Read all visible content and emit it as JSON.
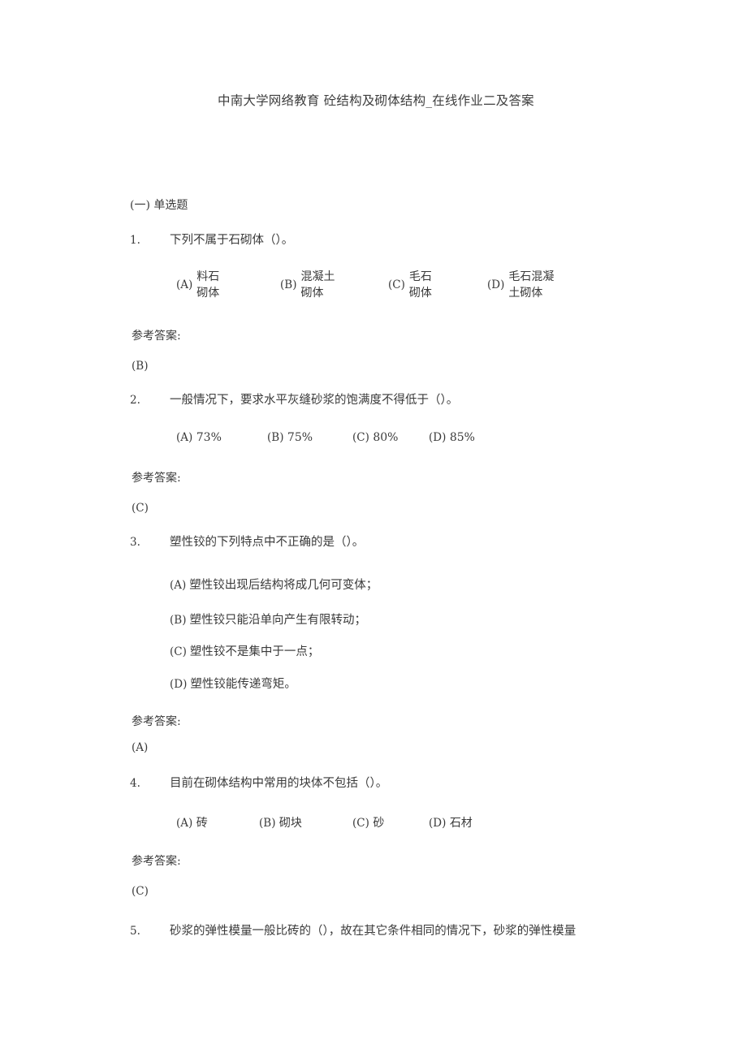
{
  "document": {
    "title": "中南大学网络教育 砼结构及砌体结构_在线作业二及答案",
    "section_header": "(一) 单选题",
    "answer_label": "参考答案:"
  },
  "questions": [
    {
      "number": "1.",
      "text": "下列不属于石砌体（）。",
      "options": [
        {
          "letter": "(A)",
          "line1": "料石",
          "line2": "砌体"
        },
        {
          "letter": "(B)",
          "line1": "混凝土",
          "line2": "砌体"
        },
        {
          "letter": "(C)",
          "line1": "毛石",
          "line2": "砌体"
        },
        {
          "letter": "(D)",
          "line1": "毛石混凝",
          "line2": "土砌体"
        }
      ],
      "answer_label": "参考答案:",
      "answer": "(B)"
    },
    {
      "number": "2.",
      "text": "一般情况下，要求水平灰缝砂浆的饱满度不得低于（）。",
      "options": [
        {
          "letter": "(A)",
          "text": "73%"
        },
        {
          "letter": "(B)",
          "text": "75%"
        },
        {
          "letter": "(C)",
          "text": "80%"
        },
        {
          "letter": "(D)",
          "text": "85%"
        }
      ],
      "answer_label": "参考答案:",
      "answer": "(C)"
    },
    {
      "number": "3.",
      "text": "塑性铰的下列特点中不正确的是（）。",
      "options": [
        {
          "letter": "(A)",
          "text": "塑性铰出现后结构将成几何可变体；"
        },
        {
          "letter": "(B)",
          "text": "塑性铰只能沿单向产生有限转动；"
        },
        {
          "letter": "(C)",
          "text": "塑性铰不是集中于一点；"
        },
        {
          "letter": "(D)",
          "text": "塑性铰能传递弯矩。"
        }
      ],
      "answer_label": "参考答案:",
      "answer": "(A)"
    },
    {
      "number": "4.",
      "text": "目前在砌体结构中常用的块体不包括（）。",
      "options": [
        {
          "letter": "(A)",
          "text": "砖"
        },
        {
          "letter": "(B)",
          "text": "砌块"
        },
        {
          "letter": "(C)",
          "text": "砂"
        },
        {
          "letter": "(D)",
          "text": "石材"
        }
      ],
      "answer_label": "参考答案:",
      "answer": "(C)"
    },
    {
      "number": "5.",
      "text": "砂浆的弹性模量一般比砖的（），故在其它条件相同的情况下，砂浆的弹性模量"
    }
  ]
}
